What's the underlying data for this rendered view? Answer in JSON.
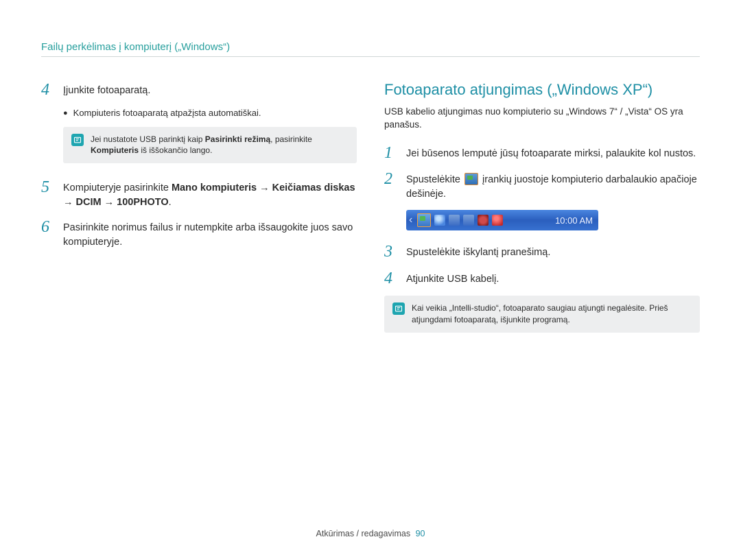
{
  "breadcrumb": "Failų perkėlimas į kompiuterį („Windows“)",
  "left": {
    "step4": {
      "num": "4",
      "text": "Įjunkite fotoaparatą.",
      "bullet": "Kompiuteris fotoaparatą atpažįsta automatiškai.",
      "note_pre": "Jei nustatote USB parinktį kaip ",
      "note_bold1": "Pasirinkti režimą",
      "note_mid": ", pasirinkite ",
      "note_bold2": "Kompiuteris",
      "note_post": " iš iššokančio lango."
    },
    "step5": {
      "num": "5",
      "pre": "Kompiuteryje pasirinkite ",
      "bold": "Mano kompiuteris → Keičiamas diskas → DCIM → 100PHOTO",
      "post": "."
    },
    "step6": {
      "num": "6",
      "text": "Pasirinkite norimus failus ir nutempkite arba išsaugokite juos savo kompiuteryje."
    }
  },
  "right": {
    "title": "Fotoaparato atjungimas („Windows XP“)",
    "intro": "USB kabelio atjungimas nuo kompiuterio su „Windows 7“ / „Vista“ OS yra panašus.",
    "step1": {
      "num": "1",
      "text": "Jei būsenos lemputė jūsų fotoaparate mirksi, palaukite kol nustos."
    },
    "step2": {
      "num": "2",
      "pre": "Spustelėkite ",
      "post": " įrankių juostoje kompiuterio darbalaukio apačioje dešinėje."
    },
    "taskbar_time": "10:00 AM",
    "step3": {
      "num": "3",
      "text": "Spustelėkite iškylantį pranešimą."
    },
    "step4": {
      "num": "4",
      "text": "Atjunkite USB kabelį."
    },
    "note": "Kai veikia „Intelli-studio“, fotoaparato saugiau atjungti negalėsite. Prieš atjungdami fotoaparatą, išjunkite programą."
  },
  "footer": {
    "label": "Atkūrimas / redagavimas",
    "page": "90"
  }
}
